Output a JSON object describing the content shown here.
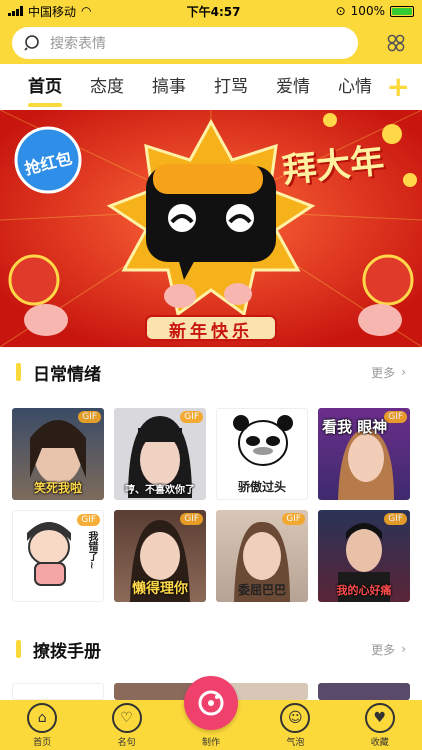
{
  "status": {
    "carrier": "中国移动",
    "time": "下午4:57",
    "battery": "100%"
  },
  "search": {
    "placeholder": "搜索表情"
  },
  "tabs": [
    "首页",
    "态度",
    "搞事",
    "打骂",
    "爱情",
    "心情"
  ],
  "banner": {
    "left_badge": "抢红包",
    "right_title": "拜大年",
    "bottom_text": "新年快乐"
  },
  "sections": [
    {
      "title": "日常情绪",
      "more": "更多",
      "thumbs": [
        {
          "caption": "笑死我啦",
          "badge": "GIF"
        },
        {
          "caption": "哼、不喜欢你了",
          "badge": "GIF"
        },
        {
          "caption": "骄傲过头",
          "badge": ""
        },
        {
          "caption": "看我 眼神",
          "badge": "GIF"
        },
        {
          "caption": "我错了~",
          "badge": "GIF"
        },
        {
          "caption": "懒得理你",
          "badge": "GIF"
        },
        {
          "caption": "委屈巴巴",
          "badge": "GIF"
        },
        {
          "caption": "我的心好痛",
          "badge": "GIF"
        }
      ]
    },
    {
      "title": "撩拨手册",
      "more": "更多"
    }
  ],
  "tabbar": [
    "首页",
    "名句",
    "制作",
    "气泡",
    "收藏"
  ],
  "colors": {
    "brand": "#fcd93b",
    "banner_red": "#d9271d",
    "create": "#f0416c"
  }
}
